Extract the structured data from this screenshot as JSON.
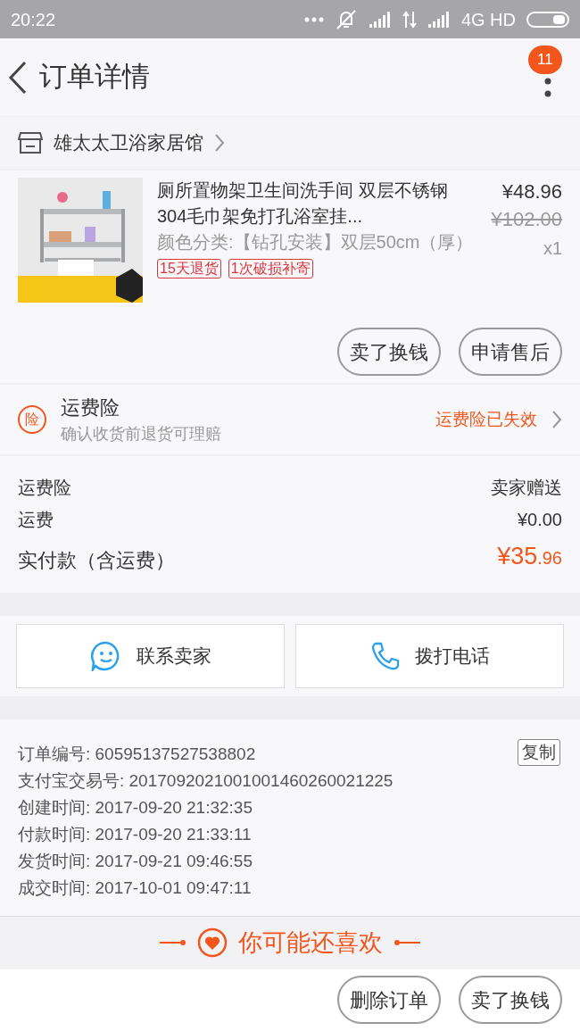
{
  "status_bar": {
    "time": "20:22",
    "network": "4G HD"
  },
  "header": {
    "title": "订单详情",
    "badge": "11"
  },
  "shop": {
    "name": "雄太太卫浴家居馆"
  },
  "product": {
    "title": "厕所置物架卫生间洗手间 双层不锈钢304毛巾架免打孔浴室挂...",
    "spec": "颜色分类:【钻孔安装】双层50cm（厚）",
    "price": "¥48.96",
    "original_price": "¥102.00",
    "quantity": "x1",
    "tags": [
      "15天退货",
      "1次破损补寄"
    ],
    "actions": [
      "卖了换钱",
      "申请售后"
    ]
  },
  "insurance": {
    "icon_char": "险",
    "title": "运费险",
    "subtitle": "确认收货前退货可理赔",
    "status": "运费险已失效"
  },
  "fees": {
    "rows": [
      {
        "label": "运费险",
        "value": "卖家赠送"
      },
      {
        "label": "运费",
        "value": "¥0.00"
      }
    ],
    "total": {
      "label": "实付款（含运费）",
      "amount_integer": "¥35",
      "amount_decimal": ".96"
    }
  },
  "contact_buttons": [
    {
      "kind": "chat",
      "label": "联系卖家"
    },
    {
      "kind": "phone",
      "label": "拨打电话"
    }
  ],
  "order_info": {
    "copy_button": "复制",
    "rows": [
      {
        "label": "订单编号:",
        "value": "60595137527538802"
      },
      {
        "label": "支付宝交易号:",
        "value": "2017092021001001460260021225"
      },
      {
        "label": "创建时间:",
        "value": "2017-09-20 21:32:35"
      },
      {
        "label": "付款时间:",
        "value": "2017-09-20 21:33:11"
      },
      {
        "label": "发货时间:",
        "value": "2017-09-21 09:46:55"
      },
      {
        "label": "成交时间:",
        "value": "2017-10-01 09:47:11"
      }
    ]
  },
  "recommend": {
    "title": "你可能还喜欢"
  },
  "bottom_actions": [
    "删除订单",
    "卖了换钱"
  ]
}
